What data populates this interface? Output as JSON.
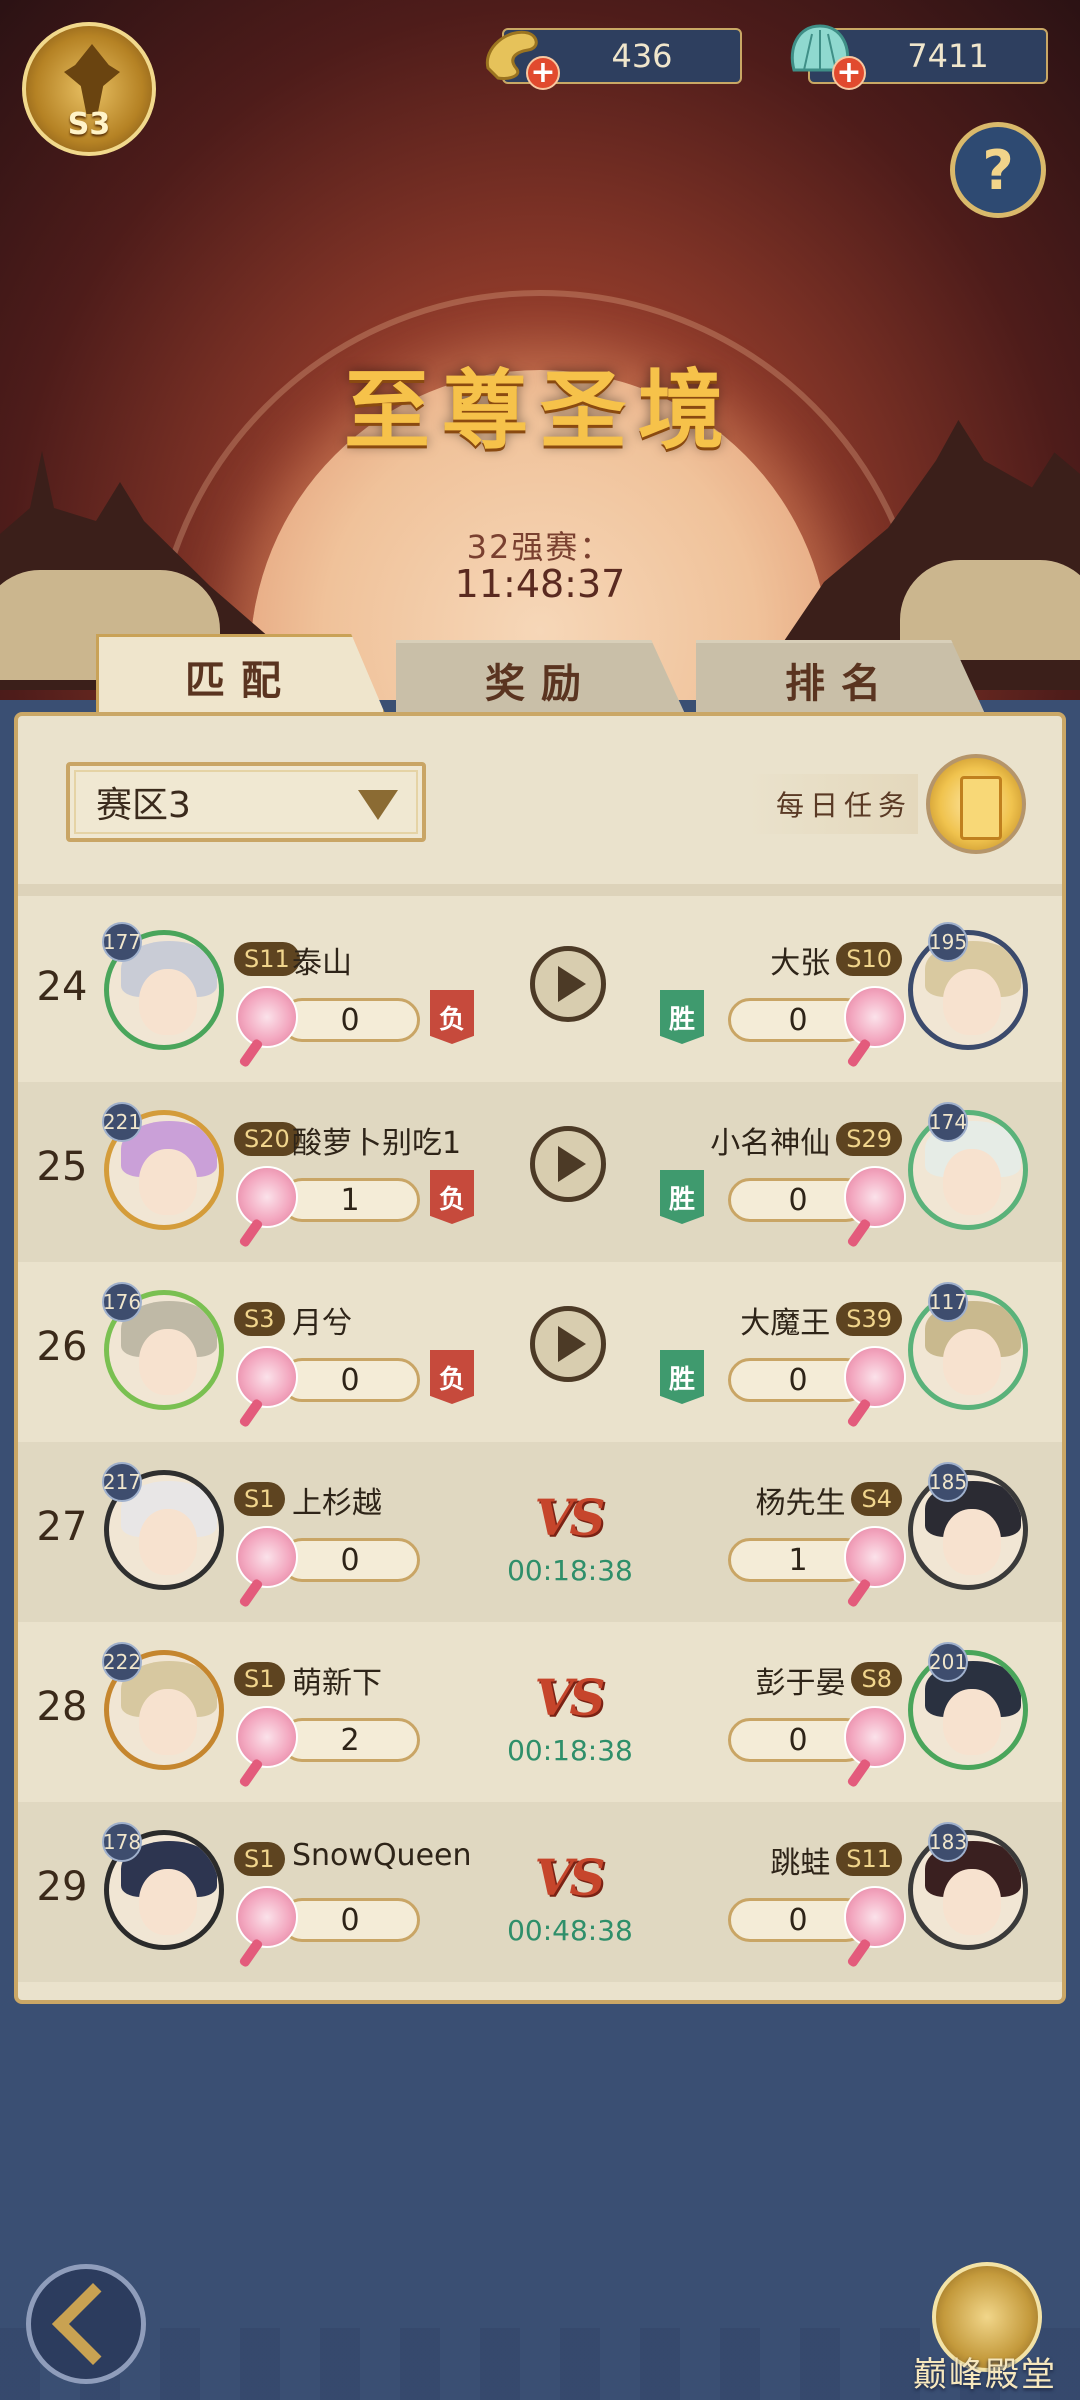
{
  "header": {
    "season_badge": "S3",
    "currency_1": {
      "icon": "dragon-coin-icon",
      "value": "436"
    },
    "currency_2": {
      "icon": "jade-shell-icon",
      "value": "7411"
    },
    "help_label": "?"
  },
  "hero": {
    "title": "至尊圣境",
    "round_label": "32强赛：",
    "countdown": "11:48:37"
  },
  "tabs": [
    {
      "label": "匹配",
      "active": true
    },
    {
      "label": "奖励",
      "active": false
    },
    {
      "label": "排名",
      "active": false
    }
  ],
  "toolbar": {
    "zone_select": "赛区3",
    "daily_task_label": "每日任务"
  },
  "matches": [
    {
      "seq": "24",
      "left": {
        "level": "177",
        "season": "S11",
        "name": "泰山",
        "score": "0",
        "result": "负"
      },
      "right": {
        "level": "195",
        "season": "S10",
        "name": "大张",
        "score": "0",
        "result": "胜"
      },
      "status": "play"
    },
    {
      "seq": "25",
      "left": {
        "level": "221",
        "season": "S20",
        "name": "酸萝卜别吃1",
        "score": "1",
        "result": "负"
      },
      "right": {
        "level": "174",
        "season": "S29",
        "name": "小名神仙",
        "score": "0",
        "result": "胜"
      },
      "status": "play"
    },
    {
      "seq": "26",
      "left": {
        "level": "176",
        "season": "S3",
        "name": "月兮",
        "score": "0",
        "result": "负"
      },
      "right": {
        "level": "117",
        "season": "S39",
        "name": "大魔王",
        "score": "0",
        "result": "胜"
      },
      "status": "play"
    },
    {
      "seq": "27",
      "left": {
        "level": "217",
        "season": "S1",
        "name": "上杉越",
        "score": "0"
      },
      "right": {
        "level": "185",
        "season": "S4",
        "name": "杨先生",
        "score": "1"
      },
      "status": "vs",
      "vs": "VS",
      "timer": "00:18:38"
    },
    {
      "seq": "28",
      "left": {
        "level": "222",
        "season": "S1",
        "name": "萌新下",
        "score": "2"
      },
      "right": {
        "level": "201",
        "season": "S8",
        "name": "彭于晏",
        "score": "0"
      },
      "status": "vs",
      "vs": "VS",
      "timer": "00:18:38"
    },
    {
      "seq": "29",
      "left": {
        "level": "178",
        "season": "S1",
        "name": "SnowQueen",
        "score": "0"
      },
      "right": {
        "level": "183",
        "season": "S11",
        "name": "跳蛙",
        "score": "0"
      },
      "status": "vs",
      "vs": "VS",
      "timer": "00:48:38"
    }
  ],
  "footer": {
    "back_icon": "back-arrow-icon",
    "hall_label": "巅峰殿堂"
  },
  "colors": {
    "title_gold": "#f6c24a",
    "panel_bg": "#eae2cc",
    "lose_red": "#c64a3c",
    "win_green": "#3f9a6e",
    "timer_green": "#2f8f6a",
    "vs_red": "#c6452b",
    "page_blue": "#3a4f73"
  }
}
